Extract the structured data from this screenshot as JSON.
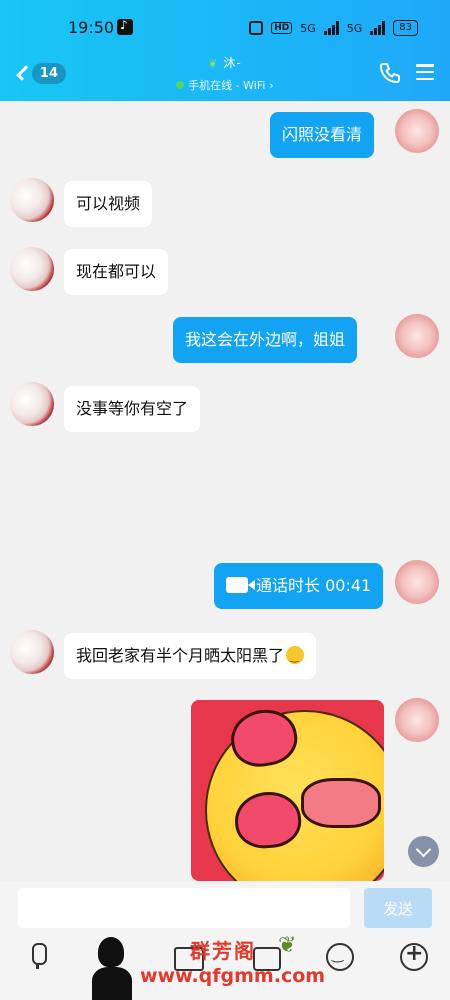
{
  "status_bar": {
    "time": "19:50",
    "network_1": "5G",
    "network_2": "5G",
    "battery": "83"
  },
  "nav": {
    "unread_count": "14",
    "contact_name": "沐-",
    "online_status": "手机在线 - WiFi",
    "status_arrow": "›"
  },
  "messages": [
    {
      "side": "me",
      "type": "text",
      "text": "闪照没看清"
    },
    {
      "side": "other",
      "type": "text",
      "text": "可以视频"
    },
    {
      "side": "other",
      "type": "text",
      "text": "现在都可以"
    },
    {
      "side": "me",
      "type": "text",
      "text": "我这会在外边啊，姐姐"
    },
    {
      "side": "other",
      "type": "text",
      "text": "没事等你有空了"
    },
    {
      "side": "me",
      "type": "call",
      "text": "通话时长 00:41"
    },
    {
      "side": "other",
      "type": "text",
      "text": "我回老家有半个月晒太阳黑了"
    },
    {
      "side": "me",
      "type": "sticker",
      "icon": "heart-eyes-kiss-sticker"
    }
  ],
  "composer": {
    "placeholder": "",
    "send_label": "发送"
  },
  "toolbar": {
    "icons": [
      "mic-icon",
      "photo-icon",
      "camera-icon",
      "emoji-icon",
      "plus-icon"
    ]
  },
  "watermark": {
    "title": "群芳阁",
    "url": "www.qfgmm.com"
  },
  "colors": {
    "header_gradient_start": "#19c6f4",
    "header_gradient_end": "#1fa8f8",
    "my_bubble": "#12a3f2",
    "other_bubble": "#ffffff",
    "send_button": "#b9dcf6",
    "watermark": "#e23a2c"
  }
}
